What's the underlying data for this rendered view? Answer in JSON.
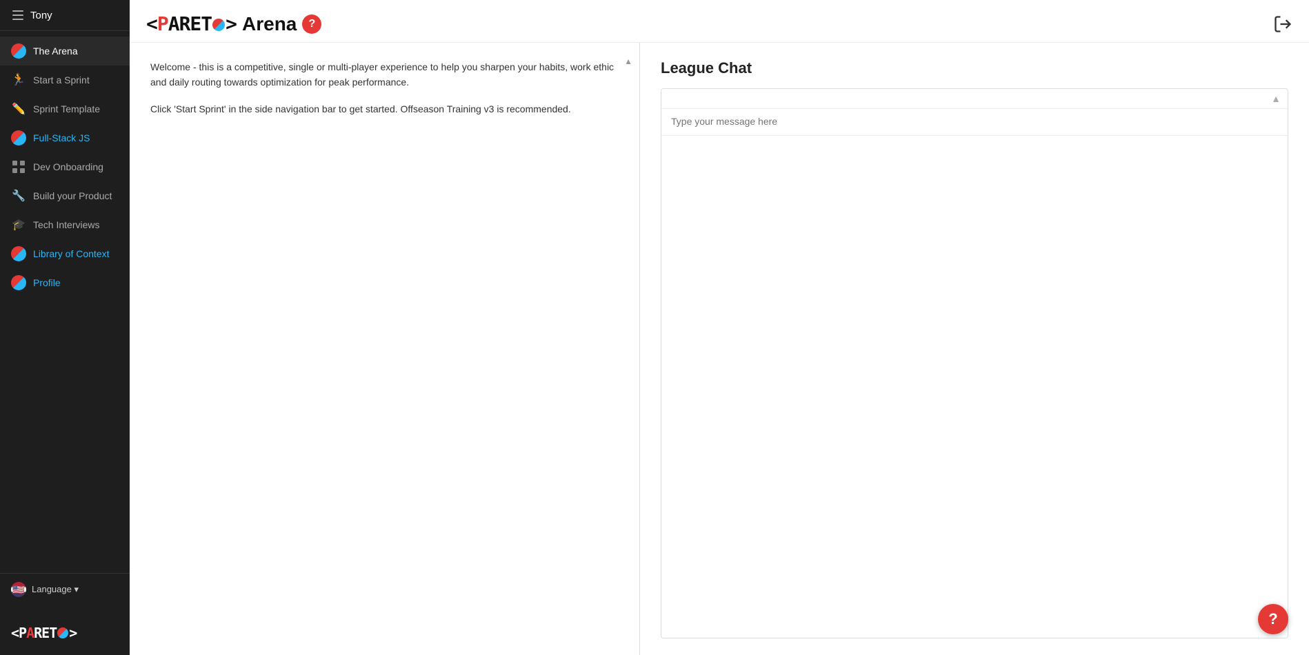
{
  "sidebar": {
    "username": "Tony",
    "items": [
      {
        "id": "the-arena",
        "label": "The Arena",
        "icon": "pareto-circle",
        "active": true
      },
      {
        "id": "start-a-sprint",
        "label": "Start a Sprint",
        "icon": "run"
      },
      {
        "id": "sprint-template",
        "label": "Sprint Template",
        "icon": "pencil"
      },
      {
        "id": "full-stack-js",
        "label": "Full-Stack JS",
        "icon": "pareto-circle",
        "highlight": true
      },
      {
        "id": "dev-onboarding",
        "label": "Dev Onboarding",
        "icon": "grid"
      },
      {
        "id": "build-your-product",
        "label": "Build your Product",
        "icon": "wrench"
      },
      {
        "id": "tech-interviews",
        "label": "Tech Interviews",
        "icon": "mortarboard"
      },
      {
        "id": "library-of-context",
        "label": "Library of Context",
        "icon": "pareto-circle",
        "highlight": true
      },
      {
        "id": "profile",
        "label": "Profile",
        "icon": "pareto-circle",
        "highlight": true
      }
    ],
    "language_label": "Language",
    "language_dropdown_arrow": "▾",
    "logo_text": "<PARETO>"
  },
  "header": {
    "brand_prefix": "<P",
    "brand_a": "A",
    "brand_r": "R",
    "brand_e": "E",
    "brand_t": "T",
    "brand_suffix": ">",
    "page_title": "<PARETO>Arena",
    "arena_label": "Arena",
    "help_icon": "?",
    "logout_icon": "⎋"
  },
  "main": {
    "welcome_line1": "Welcome - this is a competitive, single or multi-player experience to help you sharpen your habits, work ethic and daily routing towards optimization for peak performance.",
    "welcome_line2": "Click 'Start Sprint' in the side navigation bar to get started. Offseason Training v3 is recommended."
  },
  "league_chat": {
    "title": "League Chat",
    "input_placeholder": "Type your message here"
  },
  "floating_help": "?"
}
